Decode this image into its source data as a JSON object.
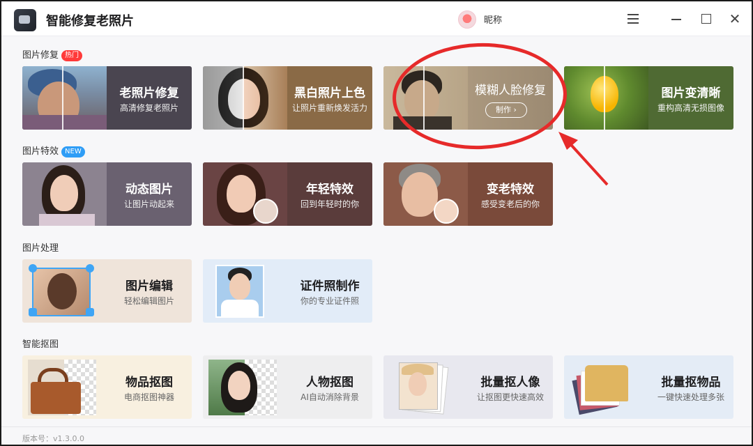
{
  "app": {
    "title": "智能修复老照片"
  },
  "user": {
    "nickname": "昵称"
  },
  "sections": {
    "repair": {
      "label": "图片修复",
      "badge": "热门"
    },
    "effects": {
      "label": "图片特效",
      "badge": "NEW"
    },
    "processing": {
      "label": "图片处理"
    },
    "cutout": {
      "label": "智能抠图"
    }
  },
  "cards": {
    "old_photo": {
      "title": "老照片修复",
      "subtitle": "高清修复老照片"
    },
    "colorize": {
      "title": "黑白照片上色",
      "subtitle": "让照片重新焕发活力"
    },
    "blur_face": {
      "title": "模糊人脸修复",
      "button": "制作 ›"
    },
    "sharpen": {
      "title": "图片变清晰",
      "subtitle": "重构高清无损图像"
    },
    "dynamic": {
      "title": "动态图片",
      "subtitle": "让图片动起来"
    },
    "younger": {
      "title": "年轻特效",
      "subtitle": "回到年轻时的你"
    },
    "older": {
      "title": "变老特效",
      "subtitle": "感受变老后的你"
    },
    "edit": {
      "title": "图片编辑",
      "subtitle": "轻松编辑图片"
    },
    "id_photo": {
      "title": "证件照制作",
      "subtitle": "你的专业证件照"
    },
    "object_cutout": {
      "title": "物品抠图",
      "subtitle": "电商抠图神器"
    },
    "person_cutout": {
      "title": "人物抠图",
      "subtitle": "AI自动消除背景"
    },
    "batch_person": {
      "title": "批量抠人像",
      "subtitle": "让抠图更快速高效"
    },
    "batch_object": {
      "title": "批量抠物品",
      "subtitle": "一键快速处理多张"
    }
  },
  "footer": {
    "version": "版本号：v1.3.0.0"
  },
  "colors": {
    "hot_badge": "#ff3a3a",
    "new_badge": "#2f9df6",
    "annotation": "#e62a2a"
  }
}
